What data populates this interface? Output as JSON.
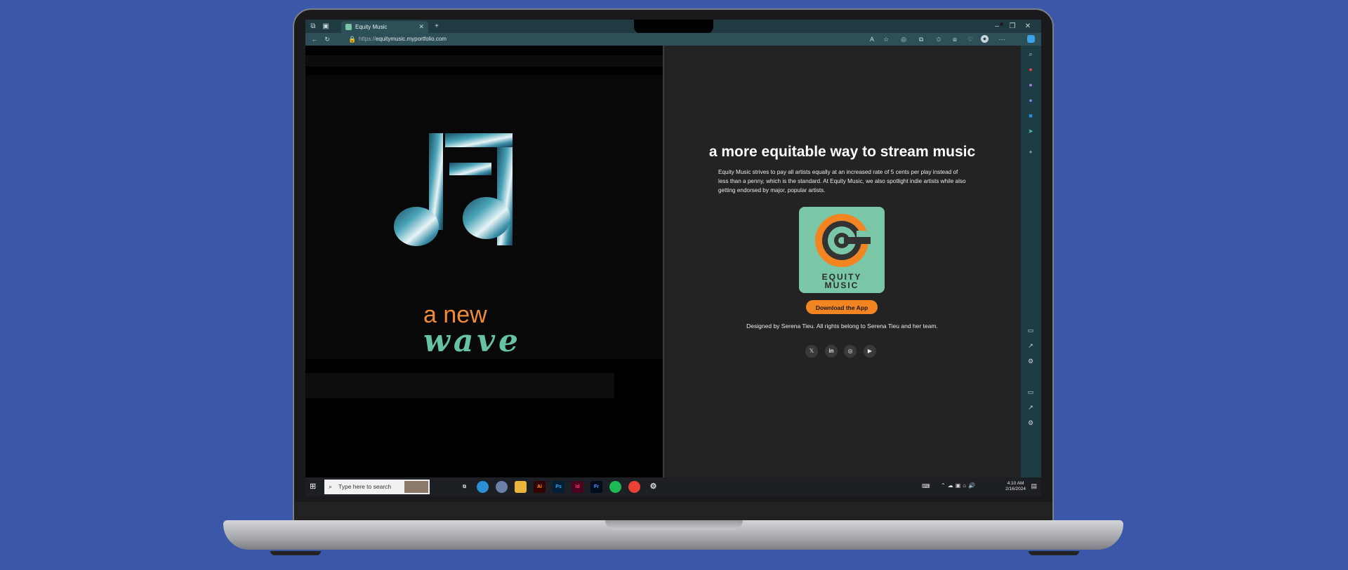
{
  "browser": {
    "tab_title": "Equity Music",
    "url_prefix": "https://",
    "url_host": "equitymusic.myportfolio.com"
  },
  "page": {
    "tagline_line1": "a new",
    "tagline_line2": "wave",
    "headline": "a more equitable way to stream music",
    "description": "Equity Music strives to pay all artists equally at an increased rate of 5 cents per play instead of less than a penny, which is the standard. At Equity Music, we also spotlight indie artists while also getting endorsed by major, popular artists.",
    "logo_text_line1": "EQUITY",
    "logo_text_line2": "MUSIC",
    "download_label": "Download the App",
    "credits": "Designed by Serena Tieu. All rights belong to Serena Tieu and her team.",
    "social": [
      "𝕏",
      "in",
      "◎",
      "▶"
    ]
  },
  "taskbar": {
    "search_placeholder": "Type here to search",
    "apps": [
      "Ai",
      "Ps",
      "Id",
      "Fr"
    ],
    "time": "4:10 AM",
    "date": "2/16/2024"
  },
  "colors": {
    "desktop": "#3a57a8",
    "accent_orange": "#f28422",
    "accent_teal": "#79c7a6",
    "browser_chrome": "#2d4f57"
  }
}
